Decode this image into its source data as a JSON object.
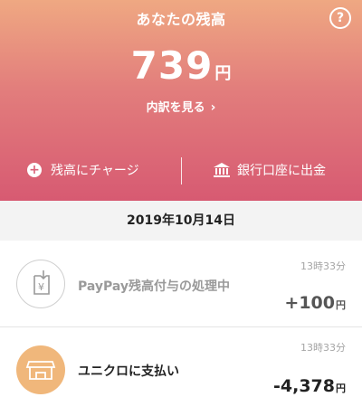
{
  "header": {
    "title": "あなたの残高",
    "help_symbol": "?",
    "balance_value": "739",
    "balance_unit": "円",
    "detail_link": "内訳を見る",
    "detail_chevron": "›",
    "actions": {
      "charge_icon": "plus-circle-icon",
      "charge_label": "残高にチャージ",
      "withdraw_icon": "bank-icon",
      "withdraw_label": "銀行口座に出金"
    }
  },
  "date_header": "2019年10月14日",
  "transactions": [
    {
      "icon": "yen-download-icon",
      "title": "PayPay残高付与の処理中",
      "time": "13時33分",
      "amount": "+100",
      "unit": "円"
    },
    {
      "icon": "storefront-icon",
      "title": "ユニクロに支払い",
      "time": "13時33分",
      "amount": "-4,378",
      "unit": "円"
    }
  ],
  "colors": {
    "gradient_top": "#efa882",
    "gradient_bottom": "#d75a72",
    "store_icon_bg": "#f0b77b"
  }
}
